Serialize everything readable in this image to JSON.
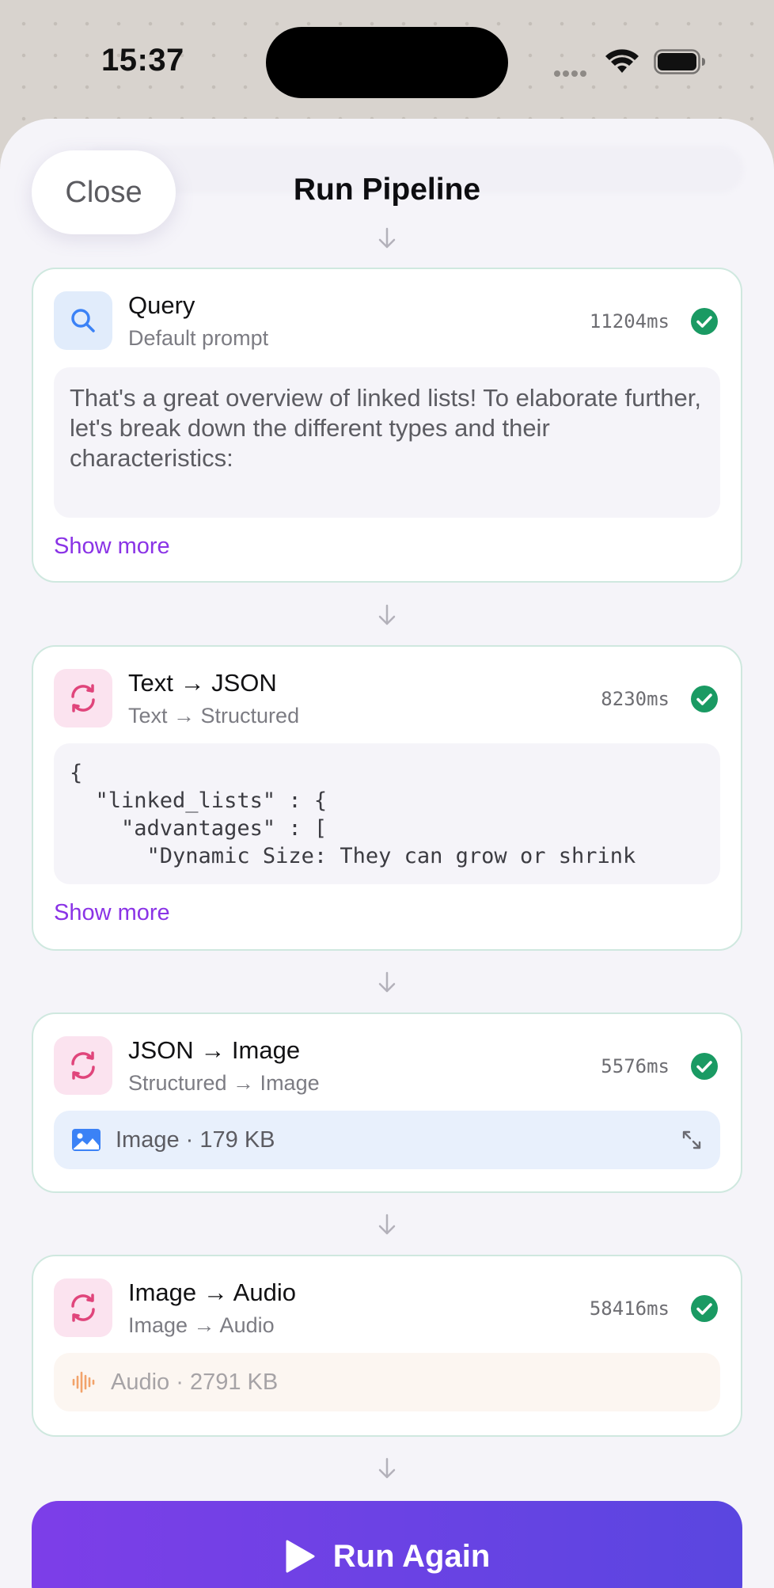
{
  "status_bar": {
    "time": "15:37"
  },
  "header": {
    "close_label": "Close",
    "title": "Run Pipeline"
  },
  "steps": [
    {
      "title": "Query",
      "subtitle": "Default prompt",
      "duration": "11204ms",
      "status": "success",
      "icon": "search-icon",
      "content": "That's a great overview of linked lists! To elaborate further, let's break down the different types and their characteristics:",
      "show_more": "Show more"
    },
    {
      "title": "Text → JSON",
      "subtitle": "Text → Structured",
      "duration": "8230ms",
      "status": "success",
      "icon": "convert-icon",
      "content": "{\n  \"linked_lists\" : {\n    \"advantages\" : [\n      \"Dynamic Size: They can grow or shrink",
      "show_more": "Show more"
    },
    {
      "title": "JSON → Image",
      "subtitle": "Structured → Image",
      "duration": "5576ms",
      "status": "success",
      "icon": "convert-icon",
      "media_label": "Image · 179 KB"
    },
    {
      "title": "Image → Audio",
      "subtitle": "Image → Audio",
      "duration": "58416ms",
      "status": "success",
      "icon": "convert-icon",
      "media_label": "Audio · 2791 KB"
    }
  ],
  "actions": {
    "run_again": "Run Again"
  },
  "colors": {
    "accent": "#8a33e6",
    "success": "#1a9a63",
    "button_gradient_start": "#7d3ee8",
    "button_gradient_end": "#5a46e0"
  }
}
